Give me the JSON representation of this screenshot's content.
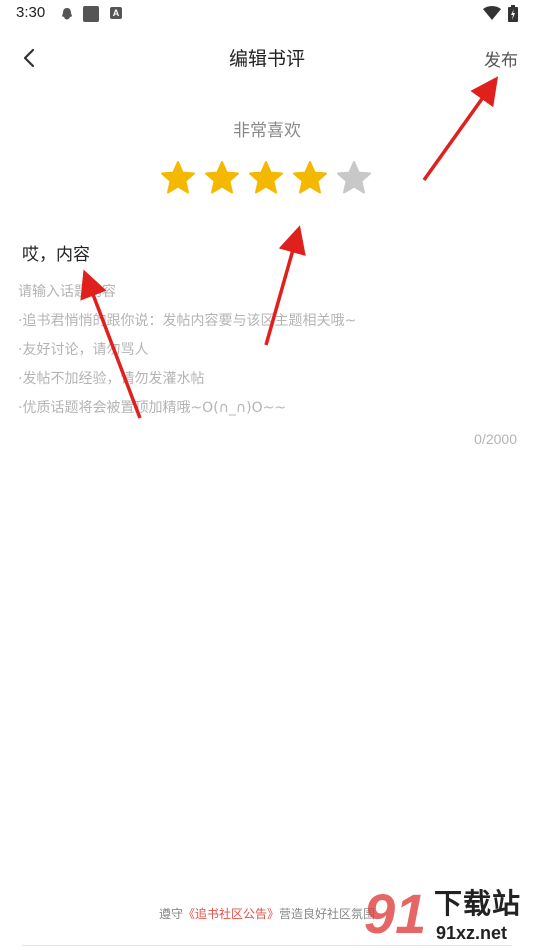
{
  "status_bar": {
    "time": "3:30",
    "icons": [
      "qq-icon",
      "notification-square-icon",
      "a-icon",
      "wifi-icon",
      "battery-icon"
    ],
    "a_glyph": "A"
  },
  "header": {
    "title": "编辑书评",
    "publish_label": "发布",
    "back_icon": "chevron-left-icon"
  },
  "rating": {
    "label": "非常喜欢",
    "value": 4,
    "max": 5,
    "filled_color": "#f5b800",
    "empty_color": "#c8c8c8"
  },
  "content": {
    "title_value": "哎，内容",
    "placeholder_lines": [
      "请输入话题内容",
      "·追书君悄悄的跟你说：发帖内容要与该区主题相关哦~",
      "·友好讨论，请勿骂人",
      " ·发帖不加经验，请勿发灌水帖",
      "·优质话题将会被置顶加精哦~O(∩_∩)O~~"
    ],
    "char_count": "0/2000"
  },
  "footer": {
    "prefix": "遵守",
    "link_text": "《追书社区公告》",
    "suffix": "营造良好社区氛围"
  },
  "watermark": {
    "number": "91",
    "cn_text": "下载站",
    "url_text": "91xz.net"
  },
  "colors": {
    "annotation_arrow": "#e0201c",
    "link": "#e0514a"
  }
}
